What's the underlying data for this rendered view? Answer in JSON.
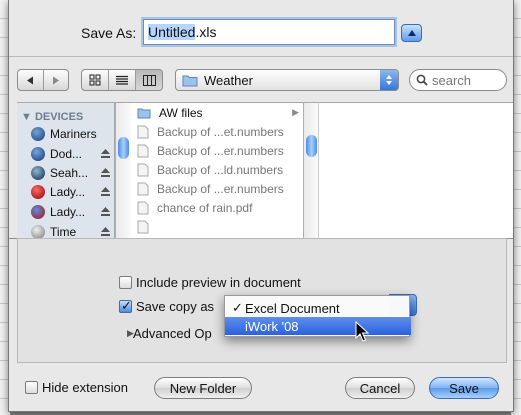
{
  "dialog": {
    "save_as_label": "Save As:",
    "filename_selected": "Untitled",
    "filename_ext": ".xls"
  },
  "toolbar": {
    "location": "Weather",
    "search_placeholder": "search"
  },
  "sidebar": {
    "heading": "DEVICES",
    "items": [
      {
        "label": "Mariners",
        "icon": "disk-icon",
        "eject": false
      },
      {
        "label": "Dod...",
        "icon": "disk-icon",
        "eject": true
      },
      {
        "label": "Seah...",
        "icon": "disk-icon",
        "eject": true
      },
      {
        "label": "Lady...",
        "icon": "disk-icon",
        "eject": true
      },
      {
        "label": "Lady...",
        "icon": "disk-icon",
        "eject": true
      },
      {
        "label": "Time",
        "icon": "disk-icon",
        "eject": true
      }
    ]
  },
  "files": [
    {
      "name": "AW files",
      "type": "folder"
    },
    {
      "name": "Backup of ...et.numbers",
      "type": "file"
    },
    {
      "name": "Backup of ...er.numbers",
      "type": "file"
    },
    {
      "name": "Backup of ...ld.numbers",
      "type": "file"
    },
    {
      "name": "Backup of ...er.numbers",
      "type": "file"
    },
    {
      "name": "chance of rain.pdf",
      "type": "file"
    }
  ],
  "options": {
    "include_preview": "Include preview in document",
    "save_copy_as": "Save copy as",
    "advanced": "Advanced Op"
  },
  "format_menu": {
    "items": [
      {
        "label": "Excel Document",
        "checked": true
      },
      {
        "label": "iWork '08",
        "checked": false
      }
    ]
  },
  "footer": {
    "hide_extension": "Hide extension",
    "new_folder": "New Folder",
    "cancel": "Cancel",
    "save": "Save"
  },
  "colors": {
    "accent": "#3677d8",
    "highlight": "#2c61de"
  }
}
